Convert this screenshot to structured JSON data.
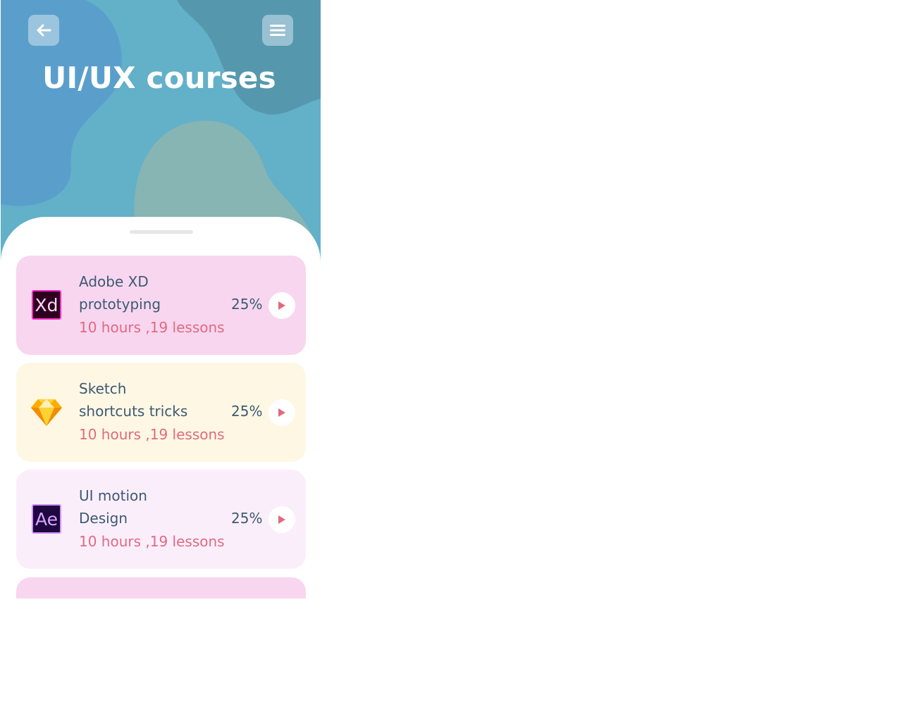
{
  "header": {
    "title": "UI/UX courses",
    "back_icon": "arrow-left-icon",
    "menu_icon": "hamburger-menu-icon"
  },
  "colors": {
    "hero_bg": "#63b0c9",
    "title_text": "#3c5a73",
    "meta_text": "#e2697f",
    "play_icon": "#e2697f"
  },
  "courses": [
    {
      "logo_text": "Xd",
      "logo_icon": "adobe-xd-icon",
      "title_line1": "Adobe XD",
      "title_line2": "prototyping",
      "meta": "10 hours ,19 lessons",
      "progress": "25%",
      "bg": "#f8d6ef"
    },
    {
      "logo_text": "",
      "logo_icon": "sketch-diamond-icon",
      "title_line1": "Sketch",
      "title_line2": "shortcuts tricks",
      "meta": "10 hours ,19 lessons",
      "progress": "25%",
      "bg": "#fef7e4"
    },
    {
      "logo_text": "Ae",
      "logo_icon": "after-effects-icon",
      "title_line1": "UI motion",
      "title_line2": "Design",
      "meta": "10 hours ,19 lessons",
      "progress": "25%",
      "bg": "#fbeefb"
    }
  ]
}
